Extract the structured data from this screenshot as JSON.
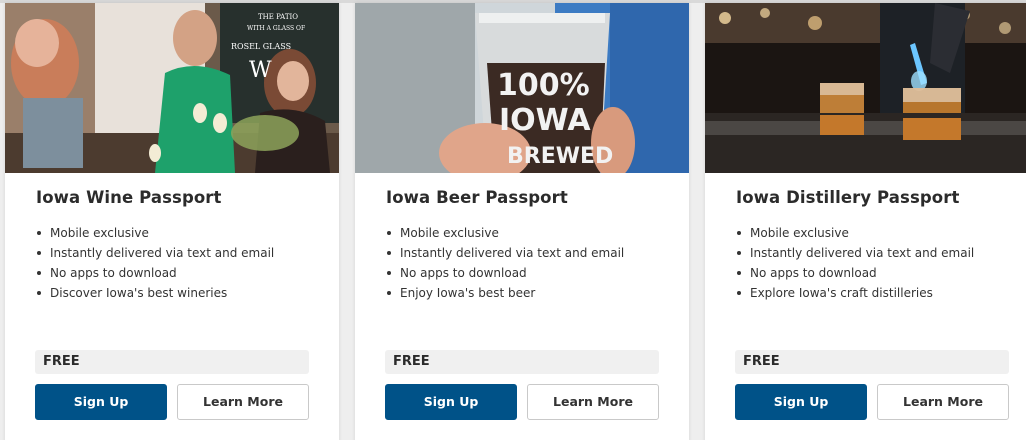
{
  "cards": [
    {
      "title": "Iowa Wine Passport",
      "features": [
        "Mobile exclusive",
        "Instantly delivered via text and email",
        "No apps to download",
        "Discover Iowa's best wineries"
      ],
      "price": "FREE",
      "signup_label": "Sign Up",
      "learn_label": "Learn More",
      "photo_text": [
        "THE PATIO",
        "WITH A GLASS OF",
        "ROSEL GLASS",
        "W"
      ]
    },
    {
      "title": "Iowa Beer Passport",
      "features": [
        "Mobile exclusive",
        "Instantly delivered via text and email",
        "No apps to download",
        "Enjoy Iowa's best beer"
      ],
      "price": "FREE",
      "signup_label": "Sign Up",
      "learn_label": "Learn More",
      "photo_text": [
        "100%",
        "IOWA",
        "BREWED"
      ]
    },
    {
      "title": "Iowa Distillery Passport",
      "features": [
        "Mobile exclusive",
        "Instantly delivered via text and email",
        "No apps to download",
        "Explore Iowa's craft distilleries"
      ],
      "price": "FREE",
      "signup_label": "Sign Up",
      "learn_label": "Learn More"
    }
  ],
  "colors": {
    "primary_button": "#005288",
    "price_background": "#f0f0f0"
  }
}
